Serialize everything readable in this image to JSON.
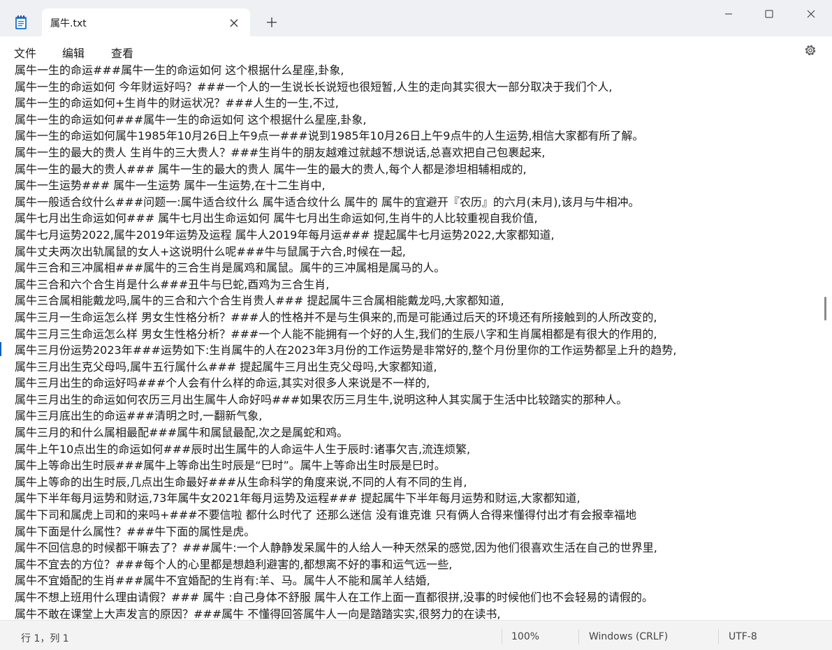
{
  "tab": {
    "title": "属牛.txt"
  },
  "menu": {
    "file": "文件",
    "edit": "编辑",
    "view": "查看"
  },
  "lines": [
    "属牛一生的命运###属牛一生的命运如何 这个根据什么星座,卦象,",
    "属牛一生的命运如何 今年财运好吗？###一个人的一生说长长说短也很短暂,人生的走向其实很大一部分取决于我们个人,",
    "属牛一生的命运如何+生肖牛的财运状况？###人生的一生,不过,",
    "属牛一生的命运如何###属牛一生的命运如何 这个根据什么星座,卦象,",
    "属牛一生的命运如何属牛1985年10月26日上午9点一###说到1985年10月26日上午9点牛的人生运势,相信大家都有所了解。",
    "属牛一生的最大的贵人 生肖牛的三大贵人？###生肖牛的朋友越难过就越不想说话,总喜欢把自己包裹起来,",
    "属牛一生的最大的贵人### 属牛一生的最大的贵人 属牛一生的最大的贵人,每个人都是渗坦相辅相成的,",
    "属牛一生运势### 属牛一生运势 属牛一生运势,在十二生肖中,",
    "属牛一般适合纹什么###问题一:属牛适合纹什么 属牛适合纹什么 属牛的 属牛的宜避开『农历』的六月(未月),该月与牛相冲。",
    "属牛七月出生命运如何### 属牛七月出生命运如何 属牛七月出生命运如何,生肖牛的人比较重视自我价值,",
    "属牛七月运势2022,属牛2019年运势及运程 属牛人2019年每月运### 提起属牛七月运势2022,大家都知道,",
    "属牛丈夫两次出轨属鼠的女人+这说明什么呢###牛与鼠属于六合,时候在一起,",
    "属牛三合和三冲属相###属牛的三合生肖是属鸡和属鼠。属牛的三冲属相是属马的人。",
    "属牛三合和六个合生肖是什么###丑牛与巳蛇,酉鸡为三合生肖,",
    "属牛三合属相能戴龙吗,属牛的三合和六个合生肖贵人### 提起属牛三合属相能戴龙吗,大家都知道,",
    "属牛三月一生命运怎么样 男女生性格分析？###人的性格并不是与生俱来的,而是可能通过后天的环境还有所接触到的人所改变的,",
    "属牛三月三生命运怎么样 男女生性格分析？###一个人能不能拥有一个好的人生,我们的生辰八字和生肖属相都是有很大的作用的,",
    "属牛三月份运势2023年###运势如下:生肖属牛的人在2023年3月份的工作运势是非常好的,整个月份里你的工作运势都呈上升的趋势,",
    "属牛三月出生克父母吗,属牛五行属什么### 提起属牛三月出生克父母吗,大家都知道,",
    "属牛三月出生的命运好吗###个人会有什么样的命运,其实对很多人来说是不一样的,",
    "属牛三月出生的命运如何农历三月出生属牛人命好吗###如果农历三月生牛,说明这种人其实属于生活中比较踏实的那种人。",
    "属牛三月底出生的命运###清明之时,一翻新气象,",
    "属牛三月的和什么属相最配###属牛和属鼠最配,次之是属蛇和鸡。",
    "属牛上午10点出生的命运如何###辰时出生属牛的人命运牛人生于辰时:诸事欠吉,流连烦繁,",
    "属牛上等命出生时辰###属牛上等命出生时辰是“巳时”。属牛上等命出生时辰是巳时。",
    "属牛上等命的出生时辰,几点出生命最好###从生命科学的角度来说,不同的人有不同的生肖,",
    "属牛下半年每月运势和财运,73年属牛女2021年每月运势及运程### 提起属牛下半年每月运势和财运,大家都知道,",
    "属牛下司和属虎上司和的来吗+###不要信啦 都什么时代了 还那么迷信 没有谁克谁 只有俩人合得来懂得付出才有会报幸福地",
    "属牛下面是什么属性？###牛下面的属性是虎。",
    "属牛不回信息的时候都干嘛去了？###属牛:一个人静静发呆属牛的人给人一种天然呆的感觉,因为他们很喜欢生活在自己的世界里,",
    "属牛不宜去的方位？###每个人的心里都是想趋利避害的,都想离不好的事和运气远一些,",
    "属牛不宜婚配的生肖###属牛不宜婚配的生肖有:羊、马。属牛人不能和属羊人结婚,",
    "属牛不想上班用什么理由请假？### 属牛 :自己身体不舒服 属牛人在工作上面一直都很拼,没事的时候他们也不会轻易的请假的。",
    "属牛不敢在课堂上大声发言的原因？###属牛 不懂得回答属牛人一向是踏踏实实,很努力的在读书,"
  ],
  "status": {
    "position": "行 1，列 1",
    "zoom": "100%",
    "line_ending": "Windows (CRLF)",
    "encoding": "UTF-8"
  }
}
